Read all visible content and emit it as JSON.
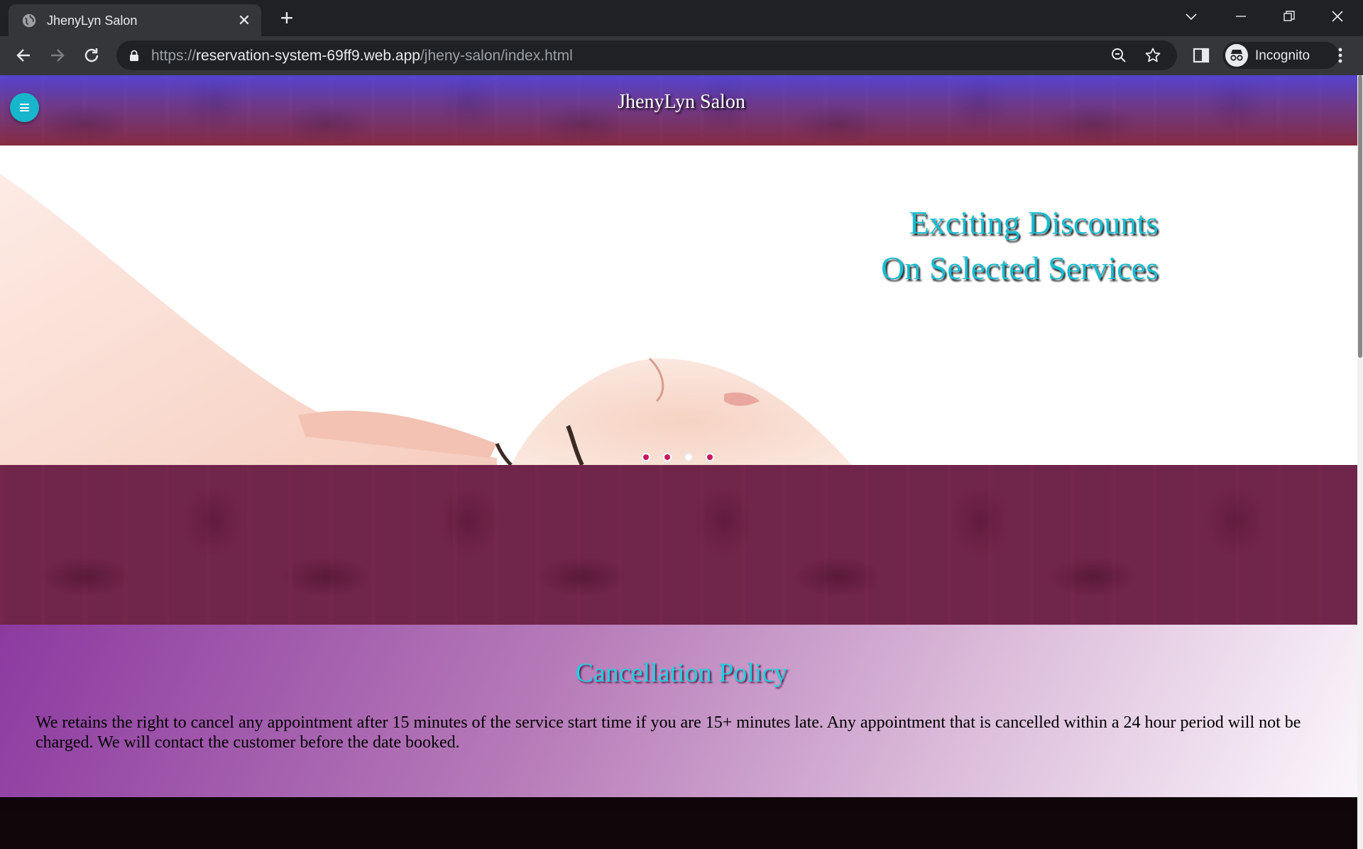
{
  "browser": {
    "tab_title": "JhenyLyn Salon",
    "url_scheme": "https://",
    "url_host": "reservation-system-69ff9.web.app",
    "url_path": "/jheny-salon/index.html",
    "profile_label": "Incognito"
  },
  "header": {
    "title": "JhenyLyn Salon",
    "menu_icon": "hamburger-icon",
    "accent": "#17b6cd"
  },
  "hero": {
    "line1": "Exciting Discounts",
    "line2": "On Selected Services",
    "slides": 4,
    "active_slide": 3,
    "text_color": "#19bcd0"
  },
  "policy": {
    "title": "Cancellation Policy",
    "body": "We retains the right to cancel any appointment after 15 minutes of the service start time if you are 15+ minutes late. Any appointment that is cancelled within a 24 hour period will not be charged. We will contact the customer before the date booked."
  }
}
